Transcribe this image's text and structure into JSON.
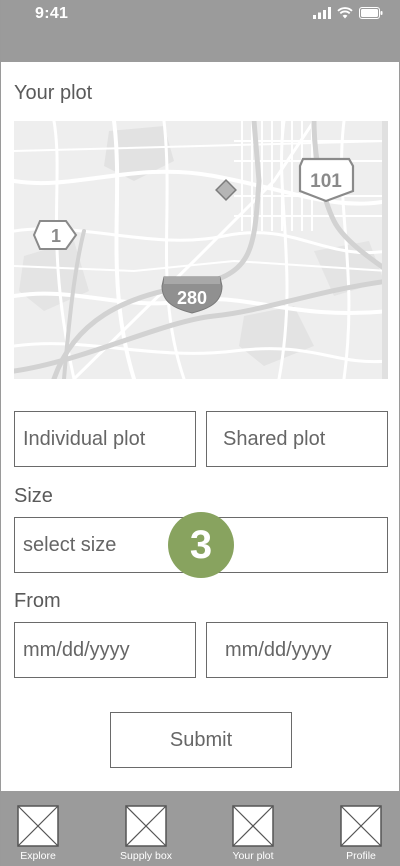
{
  "status_bar": {
    "time": "9:41"
  },
  "plot_section": {
    "heading": "Your plot"
  },
  "map": {
    "route_1": "1",
    "route_101": "101",
    "route_280": "280"
  },
  "plot_type": {
    "individual_label": "Individual plot",
    "shared_label": "Shared plot"
  },
  "size": {
    "heading": "Size",
    "placeholder": "select size"
  },
  "from": {
    "heading": "From",
    "start_placeholder": "mm/dd/yyyy",
    "end_placeholder": "mm/dd/yyyy"
  },
  "step_badge": "3",
  "submit_label": "Submit",
  "bottom_nav": {
    "items": [
      {
        "label": "Explore",
        "icon": "placeholder-image-icon"
      },
      {
        "label": "Supply box",
        "icon": "placeholder-image-icon"
      },
      {
        "label": "Your plot",
        "icon": "placeholder-image-icon"
      },
      {
        "label": "Profile",
        "icon": "placeholder-image-icon"
      }
    ]
  },
  "colors": {
    "bar_gray": "#9b9b9b",
    "accent_green": "#88a35f",
    "border": "#6a6a6a"
  }
}
